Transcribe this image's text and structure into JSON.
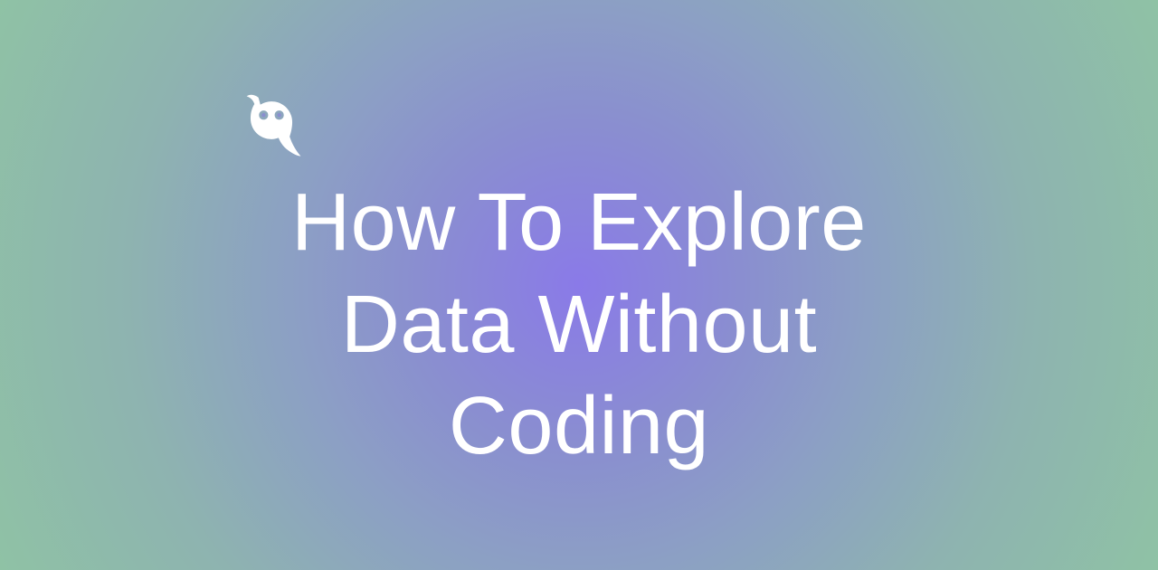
{
  "hero": {
    "title": "How To Explore Data Without Coding",
    "icon_name": "owl-icon"
  }
}
